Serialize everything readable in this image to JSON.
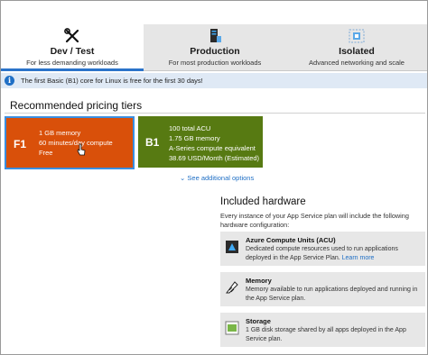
{
  "tabs": [
    {
      "title": "Dev / Test",
      "subtitle": "For less demanding workloads",
      "icon": "tools-icon",
      "active": true
    },
    {
      "title": "Production",
      "subtitle": "For most production workloads",
      "icon": "server-icon",
      "active": false
    },
    {
      "title": "Isolated",
      "subtitle": "Advanced networking and scale",
      "icon": "isolated-network-icon",
      "active": false
    }
  ],
  "banner": {
    "text": "The first Basic (B1) core for Linux is free for the first 30 days!",
    "icon": "info-icon"
  },
  "pricing": {
    "section_title": "Recommended pricing tiers",
    "tiers": [
      {
        "code": "F1",
        "lines": [
          "1 GB memory",
          "60 minutes/day compute",
          "Free"
        ],
        "color": "#d9500a",
        "selected": true
      },
      {
        "code": "B1",
        "lines": [
          "100 total ACU",
          "1.75 GB memory",
          "A-Series compute equivalent",
          "38.69 USD/Month (Estimated)"
        ],
        "color": "#577a12",
        "selected": false
      }
    ],
    "see_more": "See additional options"
  },
  "hardware": {
    "title": "Included hardware",
    "intro": "Every instance of your App Service plan will include the following hardware configuration:",
    "items": [
      {
        "name": "Azure Compute Units (ACU)",
        "desc": "Dedicated compute resources used to run applications deployed in the App Service Plan.",
        "link": "Learn more",
        "icon": "compute-icon"
      },
      {
        "name": "Memory",
        "desc": "Memory available to run applications deployed and running in the App Service plan.",
        "icon": "memory-icon"
      },
      {
        "name": "Storage",
        "desc": "1 GB disk storage shared by all apps deployed in the App Service plan.",
        "icon": "storage-icon"
      }
    ]
  },
  "colors": {
    "accent": "#2b73c9",
    "link": "#1f6fc5",
    "banner_bg": "#dfe9f5"
  }
}
